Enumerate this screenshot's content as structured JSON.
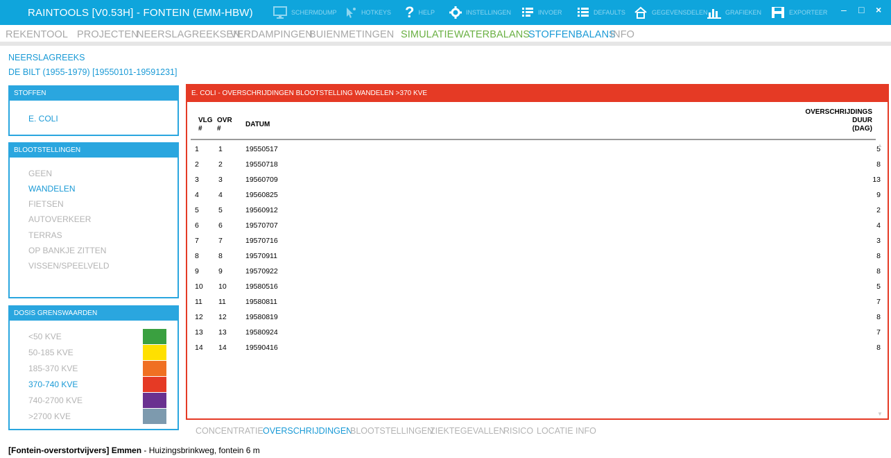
{
  "window": {
    "title": "RAINTOOLS [V0.53H] - FONTEIN (EMM-HBW)",
    "toolbar": [
      {
        "label": "SCHERMDUMP",
        "icon": "monitor-icon"
      },
      {
        "label": "HOTKEYS",
        "icon": "cursor-icon"
      },
      {
        "label": "HELP",
        "icon": "question-icon"
      },
      {
        "label": "INSTELLINGEN",
        "icon": "gear-icon"
      },
      {
        "label": "INVOER",
        "icon": "list-input-icon"
      },
      {
        "label": "DEFAULTS",
        "icon": "list-defaults-icon"
      },
      {
        "label": "GEGEVENSDELEN",
        "icon": "home-icon"
      },
      {
        "label": "GRAFIEKEN",
        "icon": "chart-icon"
      },
      {
        "label": "EXPORTEER",
        "icon": "save-icon"
      }
    ],
    "controls": {
      "minimize": "–",
      "maximize": "□",
      "close": "×"
    }
  },
  "menu": [
    "REKENTOOL",
    "PROJECTEN",
    "NEERSLAGREEKSEN",
    "VERDAMPINGEN",
    "BUIEN",
    "METINGEN",
    "SIMULATIE",
    "WATERBALANS",
    "STOFFENBALANS",
    "INFO"
  ],
  "neerslagreeks": {
    "label": "NEERSLAGREEKS",
    "value": "DE BILT (1955-1979) [19550101-19591231]"
  },
  "stoffen": {
    "title": "STOFFEN",
    "items": [
      "E. COLI"
    ]
  },
  "blootstellingen": {
    "title": "BLOOTSTELLINGEN",
    "items": [
      "GEEN",
      "WANDELEN",
      "FIETSEN",
      "AUTOVERKEER",
      "TERRAS",
      "OP BANKJE ZITTEN",
      "VISSEN/SPEELVELD"
    ]
  },
  "dosis": {
    "title": "DOSIS GRENSWAARDEN",
    "items": [
      {
        "label": "<50 KVE",
        "color": "#3aa040"
      },
      {
        "label": "50-185 KVE",
        "color": "#ffe000"
      },
      {
        "label": "185-370 KVE",
        "color": "#f07022"
      },
      {
        "label": "370-740 KVE",
        "color": "#e53a25"
      },
      {
        "label": "740-2700 KVE",
        "color": "#6a3190"
      },
      {
        "label": ">2700 KVE",
        "color": "#7d9aae"
      }
    ]
  },
  "results": {
    "title": "E. COLI - OVERSCHRIJDINGEN BLOOTSTELLING WANDELEN >370 KVE",
    "columns": {
      "vlg": [
        "VLG",
        "#"
      ],
      "ovr": [
        "OVR",
        "#"
      ],
      "datum": "DATUM",
      "duur": [
        "OVERSCHRIJDINGS",
        "DUUR",
        "(DAG)"
      ]
    },
    "rows": [
      [
        "1",
        "1",
        "19550517",
        "5"
      ],
      [
        "2",
        "2",
        "19550718",
        "8"
      ],
      [
        "3",
        "3",
        "19560709",
        "13"
      ],
      [
        "4",
        "4",
        "19560825",
        "9"
      ],
      [
        "5",
        "5",
        "19560912",
        "2"
      ],
      [
        "6",
        "6",
        "19570707",
        "4"
      ],
      [
        "7",
        "7",
        "19570716",
        "3"
      ],
      [
        "8",
        "8",
        "19570911",
        "8"
      ],
      [
        "9",
        "9",
        "19570922",
        "8"
      ],
      [
        "10",
        "10",
        "19580516",
        "5"
      ],
      [
        "11",
        "11",
        "19580811",
        "7"
      ],
      [
        "12",
        "12",
        "19580819",
        "8"
      ],
      [
        "13",
        "13",
        "19580924",
        "7"
      ],
      [
        "14",
        "14",
        "19590416",
        "8"
      ]
    ]
  },
  "tabs": [
    "CONCENTRATIE",
    "OVERSCHRIJDINGEN",
    "BLOOTSTELLINGEN",
    "ZIEKTEGEVALLEN",
    "RISICO",
    "LOCATIE",
    "INFO"
  ],
  "status": {
    "bold": "[Fontein-overstortvijvers] Emmen",
    "rest": " - Huizingsbrinkweg, fontein 6 m"
  }
}
